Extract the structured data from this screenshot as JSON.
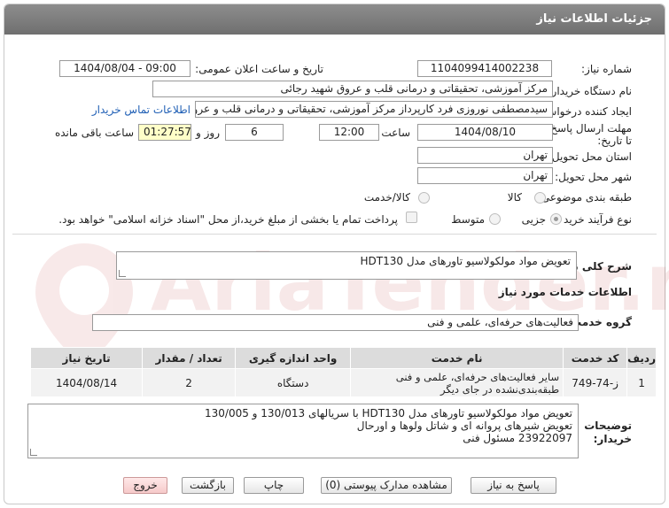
{
  "header": {
    "title": "جزئیات اطلاعات نیاز"
  },
  "form": {
    "need_number_label": "شماره نیاز:",
    "need_number": "1104099414002238",
    "announce_label": "تاریخ و ساعت اعلان عمومی:",
    "announce_value": "1404/08/04 - 09:00",
    "buyer_label": "نام دستگاه خریدار:",
    "buyer_value": "مرکز آموزشی، تحقیقاتی و درمانی قلب و عروق شهید رجائی",
    "creator_label": "ایجاد کننده درخواست:",
    "creator_value": "سیدمصطفی نوروزی فرد کارپرداز مرکز آموزشی، تحقیقاتی و درمانی قلب و عروق",
    "contact_link": "اطلاعات تماس خریدار",
    "deadline_label": "مهلت ارسال پاسخ: تا تاریخ:",
    "deadline_date": "1404/08/10",
    "time_label": "ساعت",
    "deadline_time": "12:00",
    "days_value": "6",
    "days_label": "روز و",
    "remaining_time": "01:27:57",
    "remaining_label": "ساعت باقی مانده",
    "province_label": "استان محل تحویل:",
    "province_value": "تهران",
    "city_label": "شهر محل تحویل:",
    "city_value": "تهران",
    "category_label": "طبقه بندی موضوعی:",
    "category_options": [
      "کالا",
      "کالا/خدمت"
    ],
    "process_label": "نوع فرآیند خرید :",
    "process_options": [
      "جزیی",
      "متوسط"
    ],
    "payment_note": "پرداخت تمام یا بخشی از مبلغ خرید،از محل \"اسناد خزانه اسلامی\" خواهد بود."
  },
  "summary": {
    "label": "شرح کلی نیاز:",
    "value": "تعویض مواد مولکولاسیو تاورهای مدل HDT130"
  },
  "services": {
    "section_title": "اطلاعات خدمات مورد نیاز",
    "group_label": "گروه خدمت:",
    "group_value": "فعالیت‌های حرفه‌ای، علمی و فنی"
  },
  "table": {
    "headers": [
      "ردیف",
      "کد خدمت",
      "نام خدمت",
      "واحد اندازه گیری",
      "تعداد / مقدار",
      "تاریخ نیاز"
    ],
    "rows": [
      [
        "1",
        "ز-74-749",
        "سایر فعالیت‌های حرفه‌ای، علمی و فنی طبقه‌بندی‌نشده در جای دیگر",
        "دستگاه",
        "2",
        "1404/08/14"
      ]
    ]
  },
  "notes": {
    "label": "توضیحات خریدار:",
    "lines": [
      "تعویض مواد مولکولاسیو تاورهای مدل HDT130 با سریالهای 130/013 و 130/005",
      "تعویض شیرهای پروانه ای و شاتل ولوها و اورحال",
      "23922097 مسئول فنی"
    ]
  },
  "buttons": {
    "reply": "پاسخ به نیاز",
    "attachments": "مشاهده مدارک پیوستی (0)",
    "print": "چاپ",
    "back": "بازگشت",
    "exit": "خروج"
  },
  "colors": {
    "header": "#7a7a7a",
    "link": "#1f5fb5",
    "remaining_bg": "#ffffc8",
    "exit_bg": "#f6caca"
  }
}
